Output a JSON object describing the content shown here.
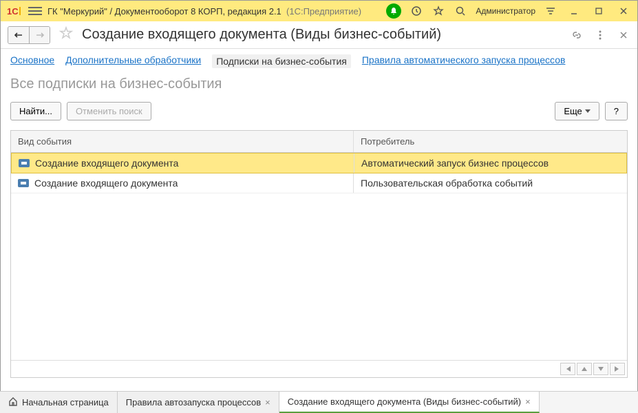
{
  "titlebar": {
    "app_title": "ГК \"Меркурий\" / Документооборот 8 КОРП, редакция 2.1",
    "platform": "(1С:Предприятие)",
    "user": "Администратор"
  },
  "page": {
    "title": "Создание входящего документа (Виды бизнес-событий)"
  },
  "tabs": {
    "main": "Основное",
    "extra": "Дополнительные обработчики",
    "subs": "Подписки на бизнес-события",
    "rules": "Правила автоматического запуска процессов"
  },
  "section_title": "Все подписки на бизнес-события",
  "buttons": {
    "find": "Найти...",
    "cancel_search": "Отменить поиск",
    "more": "Еще",
    "help": "?"
  },
  "table": {
    "headers": {
      "col1": "Вид события",
      "col2": "Потребитель"
    },
    "rows": [
      {
        "event": "Создание входящего документа",
        "consumer": "Автоматический запуск бизнес процессов",
        "selected": true
      },
      {
        "event": "Создание входящего документа",
        "consumer": "Пользовательская обработка событий",
        "selected": false
      }
    ]
  },
  "bottom_tabs": {
    "home": "Начальная страница",
    "t1": "Правила автозапуска процессов",
    "t2": "Создание входящего документа (Виды бизнес-событий)"
  }
}
